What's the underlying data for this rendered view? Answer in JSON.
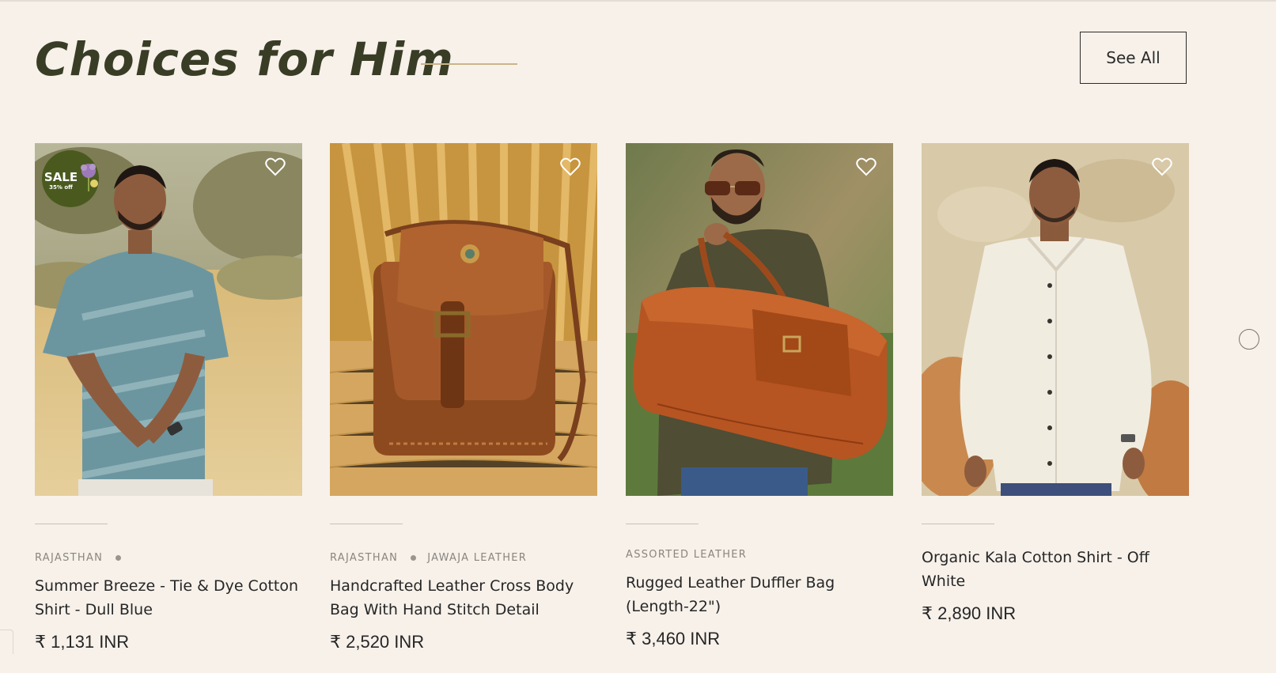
{
  "section": {
    "title": "Choices for Him",
    "see_all_label": "See All"
  },
  "badge": {
    "sale_label": "SALE",
    "discount_label": "35% off"
  },
  "products": [
    {
      "tag1": "RAJASTHAN",
      "tag2": "",
      "name": "Summer Breeze - Tie & Dye Cotton Shirt - Dull Blue",
      "price": "₹ 1,131 INR",
      "on_sale": true
    },
    {
      "tag1": "RAJASTHAN",
      "tag2": "JAWAJA LEATHER",
      "name": "Handcrafted Leather Cross Body Bag With Hand Stitch Detail",
      "price": "₹ 2,520 INR",
      "on_sale": false
    },
    {
      "tag1": "ASSORTED LEATHER",
      "tag2": "",
      "name": "Rugged Leather Duffler Bag (Length-22\")",
      "price": "₹ 3,460 INR",
      "on_sale": false
    },
    {
      "tag1": "",
      "tag2": "",
      "name": "Organic Kala Cotton Shirt - Off White",
      "price": "₹ 2,890 INR",
      "on_sale": false
    }
  ],
  "icons": {
    "wishlist": "heart-outline-icon",
    "next": "carousel-next-icon"
  },
  "colors": {
    "background": "#f7f1ea",
    "title": "#3a3d26",
    "accent_line": "#c9b58a",
    "sale_badge": "#4a5a1f"
  }
}
